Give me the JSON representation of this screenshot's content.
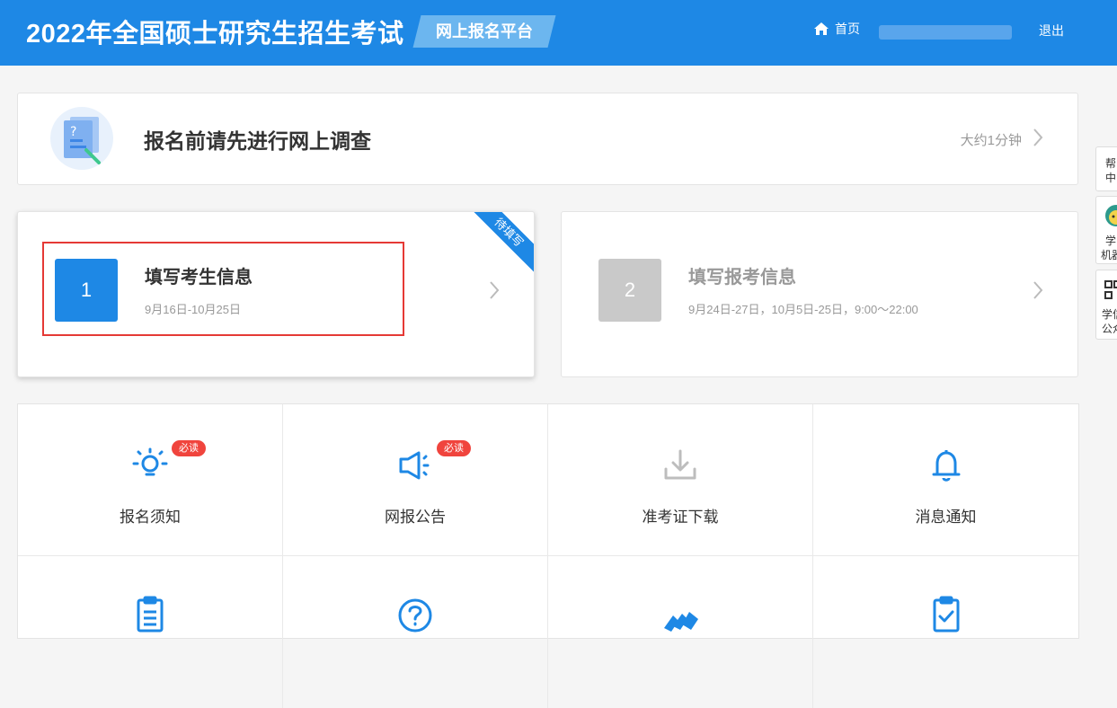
{
  "header": {
    "title": "2022年全国硕士研究生招生考试",
    "platform": "网上报名平台",
    "home": "首页",
    "logout": "退出"
  },
  "survey": {
    "title": "报名前请先进行网上调查",
    "time": "大约1分钟"
  },
  "steps": [
    {
      "num": "1",
      "title": "填写考生信息",
      "date": "9月16日-10月25日",
      "ribbon": "待填写"
    },
    {
      "num": "2",
      "title": "填写报考信息",
      "date": "9月24日-27日，10月5日-25日，9:00～22:00"
    }
  ],
  "grid": {
    "items": [
      {
        "label": "报名须知",
        "badge": "必读",
        "icon": "lightbulb-icon"
      },
      {
        "label": "网报公告",
        "badge": "必读",
        "icon": "megaphone-icon"
      },
      {
        "label": "准考证下载",
        "icon": "download-icon"
      },
      {
        "label": "消息通知",
        "icon": "bell-icon"
      },
      {
        "icon": "clipboard-list-icon"
      },
      {
        "icon": "question-circle-icon"
      },
      {
        "icon": "tickets-icon"
      },
      {
        "icon": "clipboard-check-icon"
      }
    ]
  },
  "float_panel": {
    "help": [
      "帮",
      "中"
    ],
    "robot": [
      "学",
      "机器"
    ],
    "qr": [
      "学信",
      "公众"
    ]
  },
  "colors": {
    "primary": "#1e88e5",
    "badge": "#f0443d",
    "highlight": "#e53935"
  }
}
